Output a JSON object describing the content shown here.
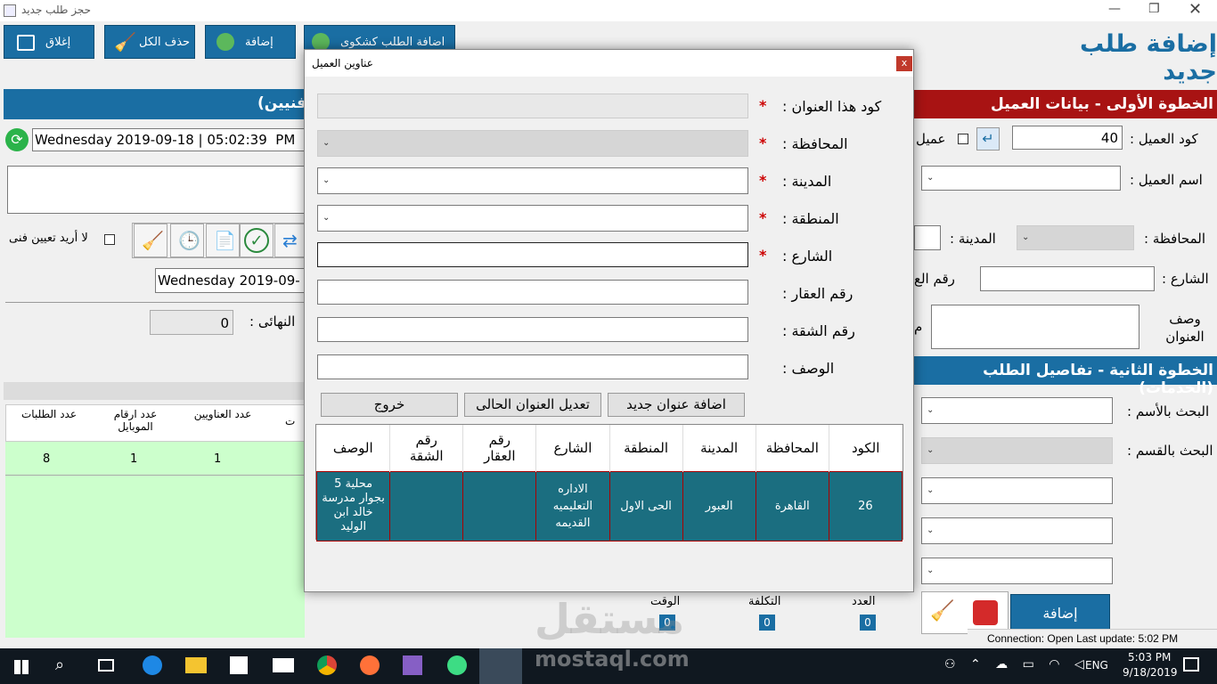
{
  "window": {
    "title": "حجز طلب جديد"
  },
  "toolbar": {
    "close_label": "إغلاق",
    "clear_label": "حذف الكل",
    "add_label": "إضافة",
    "add_complaint_label": "اضافة الطلب كشكوى"
  },
  "page_title": "إضافة طلب جديد",
  "left_header": "فنيين)",
  "datetime1": "Wednesday 2019-09-18 | 05:02:39  PM",
  "datetime2": "Wednesday 2019-09-",
  "no_tech_label": "لا أريد تعيين فنى",
  "final_label": "النهائى :",
  "final_value": "0",
  "stats": {
    "headers": [
      "عدد الطلبات",
      "عدد ارقام الموبايل",
      "عدد العناويين",
      "ت"
    ],
    "values": [
      "8",
      "1",
      "1",
      ""
    ]
  },
  "step1": {
    "title": "الخطوة الأولى - بيانات العميل",
    "customer_code_label": "كود العميل :",
    "customer_code": "40",
    "customer_checkbox_label": "عميل",
    "customer_name_label": "اسم العميل :",
    "governorate_label": "المحافظة :",
    "city_label": "المدينة :",
    "street_label": "الشارع :",
    "property_partial": "رقم الع",
    "address_desc_label": "وصف العنوان",
    "extra_char": "م"
  },
  "step2": {
    "title": "الخطوة الثانية - تفاصيل الطلب (الخدمات)",
    "search_name_label": "البحث بالأسم :",
    "search_dept_label": "البحث بالقسم :",
    "add_button": "إضافة",
    "count_label": "العدد",
    "cost_label": "التكلفة",
    "time_label": "الوقت",
    "count_value": "0",
    "cost_value": "0",
    "time_value": "0"
  },
  "dialog": {
    "title": "عناوين العميل",
    "close": "x",
    "fields": {
      "address_code": "كود هذا العنوان :",
      "governorate": "المحافظة :",
      "city": "المدينة :",
      "area": "المنطقة :",
      "street": "الشارع :",
      "property_no": "رقم العقار :",
      "apartment_no": "رقم الشقة :",
      "description": "الوصف :"
    },
    "required_mark": "*",
    "buttons": {
      "add_new": "اضافة عنوان جديد",
      "edit_current": "تعديل العنوان الحالى",
      "exit": "خروج"
    },
    "grid": {
      "headers": [
        "الكود",
        "المحافظة",
        "المدينة",
        "المنطقة",
        "الشارع",
        "رقم العقار",
        "رقم الشقة",
        "الوصف"
      ],
      "rows": [
        [
          "26",
          "القاهرة",
          "العبور",
          "الحى الاول",
          "الاداره التعليميه القديمه",
          "",
          "",
          "محلية 5 بجوار مدرسة خالد ابن الوليد"
        ]
      ]
    }
  },
  "status": "Connection: Open Last update: 5:02 PM",
  "watermark": {
    "arabic": "مستقل",
    "latin": "mostaql.com"
  },
  "taskbar": {
    "lang": "ENG",
    "time": "5:03 PM",
    "date": "9/18/2019"
  },
  "colors": {
    "blue": "#1a6ea3",
    "red": "#a81313",
    "teal": "#1b6e80",
    "green_panel": "#ccffcc"
  },
  "icons": [
    "windows-icon",
    "search-icon",
    "task-view-icon",
    "edge-icon",
    "file-explorer-icon",
    "store-icon",
    "mail-icon",
    "chrome-icon",
    "firefox-icon",
    "visual-studio-icon",
    "android-studio-icon",
    "app-icon"
  ]
}
